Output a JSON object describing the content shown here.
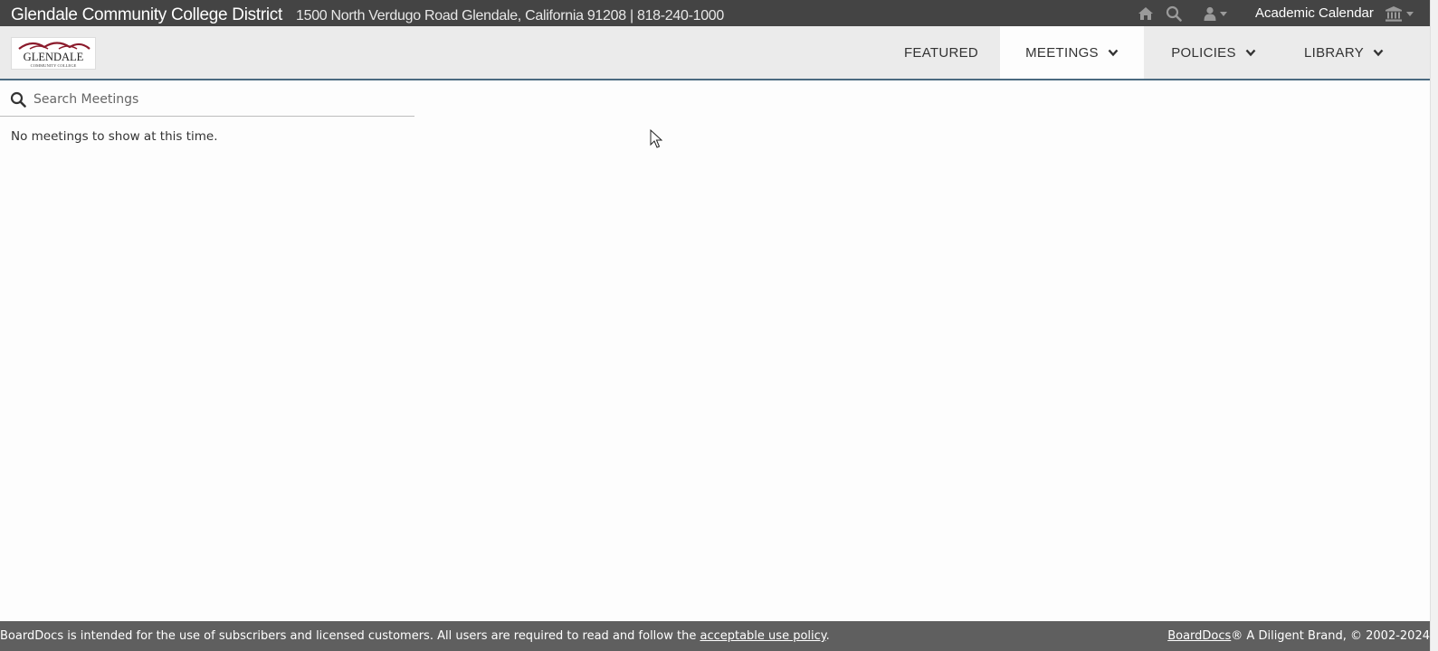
{
  "header": {
    "org_name": "Glendale Community College District",
    "org_address": "1500 North Verdugo Road Glendale, California 91208 | 818-240-1000",
    "academic_calendar": "Academic Calendar",
    "icons": [
      "home-icon",
      "search-icon",
      "user-icon",
      "institution-icon"
    ]
  },
  "logo": {
    "text": "GLENDALE",
    "subtext": "COMMUNITY COLLEGE",
    "color": "#8b1a2b"
  },
  "nav": {
    "featured": "FEATURED",
    "meetings": "MEETINGS",
    "policies": "POLICIES",
    "library": "LIBRARY",
    "active": "MEETINGS"
  },
  "search": {
    "placeholder": "Search Meetings",
    "value": ""
  },
  "main": {
    "empty_message": "No meetings to show at this time."
  },
  "footer": {
    "left_text": "BoardDocs is intended for the use of subscribers and licensed customers. All users are required to read and follow the ",
    "policy_link": "acceptable use policy",
    "left_end": ".",
    "brand_link": "BoardDocs",
    "right_text": "® A Diligent Brand, © 2002-2024"
  },
  "colors": {
    "topbar": "#444444",
    "navbar": "#ebebeb",
    "accent": "#4b6a80",
    "footer": "#5f5f5f"
  }
}
